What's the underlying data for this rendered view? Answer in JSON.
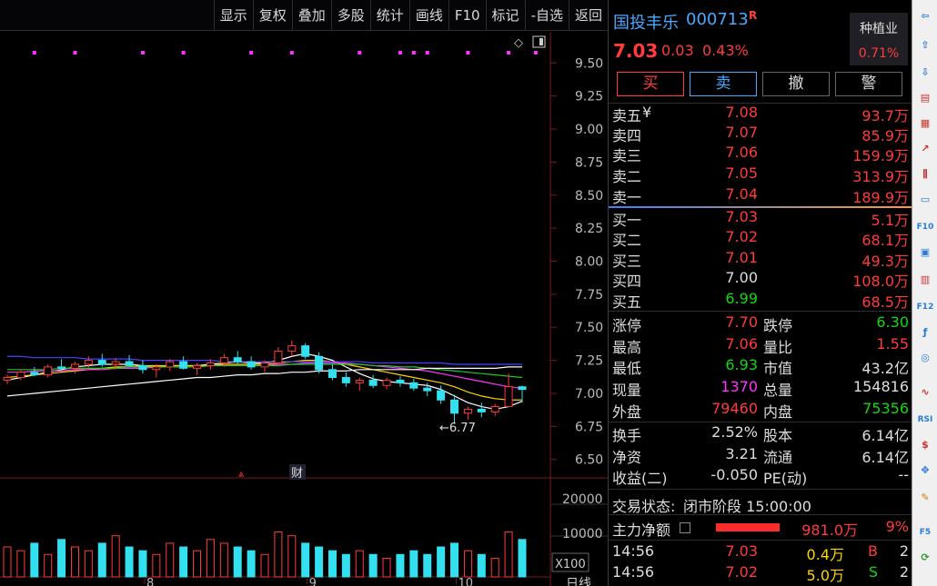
{
  "toolbar": {
    "items": [
      "显示",
      "复权",
      "叠加",
      "多股",
      "统计",
      "画线",
      "F10",
      "标记",
      "-自选",
      "返回"
    ]
  },
  "stock": {
    "name": "国投丰乐",
    "code": "000713",
    "flag": "R",
    "price": "7.03",
    "change": "0.03",
    "pct": "0.43%"
  },
  "sector": {
    "name": "种植业",
    "pct": "0.71%"
  },
  "trade_buttons": [
    "买",
    "卖",
    "撤",
    "警"
  ],
  "asks": [
    {
      "label": "卖五",
      "mark": "¥",
      "price": "7.08",
      "vol": "93.7万"
    },
    {
      "label": "卖四",
      "mark": "",
      "price": "7.07",
      "vol": "85.9万"
    },
    {
      "label": "卖三",
      "mark": "",
      "price": "7.06",
      "vol": "159.9万"
    },
    {
      "label": "卖二",
      "mark": "",
      "price": "7.05",
      "vol": "313.9万"
    },
    {
      "label": "卖一",
      "mark": "",
      "price": "7.04",
      "vol": "189.9万"
    }
  ],
  "bids": [
    {
      "label": "买一",
      "price": "7.03",
      "vol": "5.1万"
    },
    {
      "label": "买二",
      "price": "7.02",
      "vol": "68.1万"
    },
    {
      "label": "买三",
      "price": "7.01",
      "vol": "49.3万"
    },
    {
      "label": "买四",
      "price": "7.00",
      "vol": "108.0万"
    },
    {
      "label": "买五",
      "price": "6.99",
      "vol": "68.5万"
    }
  ],
  "stats": [
    {
      "l1": "涨停",
      "v1": "7.70",
      "l2": "跌停",
      "v2": "6.30"
    },
    {
      "l1": "最高",
      "v1": "7.06",
      "l2": "量比",
      "v2": "1.55"
    },
    {
      "l1": "最低",
      "v1": "6.93",
      "l2": "市值",
      "v2": "43.2亿"
    },
    {
      "l1": "现量",
      "v1": "1370",
      "l2": "总量",
      "v2": "154816"
    },
    {
      "l1": "外盘",
      "v1": "79460",
      "l2": "内盘",
      "v2": "75356"
    }
  ],
  "fund": [
    {
      "l1": "换手",
      "v1": "2.52%",
      "l2": "股本",
      "v2": "6.14亿"
    },
    {
      "l1": "净资",
      "v1": "3.21",
      "l2": "流通",
      "v2": "6.14亿"
    },
    {
      "l1": "收益(二)",
      "v1": "-0.050",
      "l2": "PE(动)",
      "v2": "--"
    }
  ],
  "status": {
    "label": "交易状态:",
    "value": "闭市阶段 15:00:00"
  },
  "main_force": {
    "label": "主力净额",
    "amount": "981.0万",
    "pct": "9%"
  },
  "ticks": [
    {
      "time": "14:56",
      "price": "7.03",
      "vol": "0.4万",
      "side": "B",
      "n": "2"
    },
    {
      "time": "14:56",
      "price": "7.02",
      "vol": "5.0万",
      "side": "S",
      "n": "2"
    }
  ],
  "price_axis": [
    "9.50",
    "9.25",
    "9.00",
    "8.75",
    "8.50",
    "8.25",
    "8.00",
    "7.75",
    "7.50",
    "7.25",
    "7.00",
    "6.75",
    "6.50"
  ],
  "vol_axis": [
    "20000",
    "10000"
  ],
  "vol_unit": "X100",
  "x_labels": [
    "8",
    "9",
    "10"
  ],
  "low_annotation": "6.77",
  "cai_label": "财",
  "period_label": "日线",
  "chart_data": {
    "type": "candlestick",
    "ylim": [
      6.45,
      9.55
    ],
    "candles": [
      [
        7.1,
        7.14,
        7.07,
        7.12
      ],
      [
        7.12,
        7.18,
        7.1,
        7.16
      ],
      [
        7.16,
        7.2,
        7.13,
        7.14
      ],
      [
        7.14,
        7.22,
        7.12,
        7.2
      ],
      [
        7.2,
        7.26,
        7.17,
        7.19
      ],
      [
        7.19,
        7.24,
        7.15,
        7.22
      ],
      [
        7.22,
        7.28,
        7.19,
        7.25
      ],
      [
        7.25,
        7.3,
        7.2,
        7.22
      ],
      [
        7.22,
        7.27,
        7.18,
        7.24
      ],
      [
        7.24,
        7.29,
        7.2,
        7.21
      ],
      [
        7.21,
        7.25,
        7.15,
        7.18
      ],
      [
        7.18,
        7.22,
        7.12,
        7.2
      ],
      [
        7.2,
        7.26,
        7.17,
        7.24
      ],
      [
        7.24,
        7.28,
        7.18,
        7.19
      ],
      [
        7.19,
        7.23,
        7.14,
        7.21
      ],
      [
        7.21,
        7.26,
        7.18,
        7.23
      ],
      [
        7.23,
        7.3,
        7.2,
        7.27
      ],
      [
        7.27,
        7.32,
        7.22,
        7.24
      ],
      [
        7.24,
        7.28,
        7.18,
        7.2
      ],
      [
        7.2,
        7.25,
        7.16,
        7.23
      ],
      [
        7.23,
        7.35,
        7.21,
        7.32
      ],
      [
        7.32,
        7.4,
        7.28,
        7.36
      ],
      [
        7.36,
        7.38,
        7.26,
        7.28
      ],
      [
        7.28,
        7.31,
        7.15,
        7.18
      ],
      [
        7.18,
        7.22,
        7.1,
        7.12
      ],
      [
        7.12,
        7.16,
        7.05,
        7.08
      ],
      [
        7.08,
        7.12,
        7.02,
        7.1
      ],
      [
        7.1,
        7.14,
        7.04,
        7.06
      ],
      [
        7.06,
        7.12,
        7.03,
        7.1
      ],
      [
        7.1,
        7.13,
        7.05,
        7.08
      ],
      [
        7.08,
        7.11,
        7.02,
        7.04
      ],
      [
        7.04,
        7.08,
        6.98,
        7.02
      ],
      [
        7.02,
        7.06,
        6.92,
        6.95
      ],
      [
        6.95,
        6.99,
        6.77,
        6.85
      ],
      [
        6.85,
        6.9,
        6.8,
        6.88
      ],
      [
        6.88,
        6.93,
        6.82,
        6.86
      ],
      [
        6.86,
        6.92,
        6.83,
        6.9
      ],
      [
        6.9,
        7.15,
        6.9,
        7.05
      ],
      [
        7.05,
        7.06,
        6.93,
        7.03
      ]
    ],
    "ma": [
      {
        "name": "MA5",
        "color": "#ffffff",
        "values": [
          7.1,
          7.12,
          7.14,
          7.16,
          7.18,
          7.2,
          7.21,
          7.22,
          7.22,
          7.22,
          7.21,
          7.2,
          7.21,
          7.21,
          7.21,
          7.22,
          7.23,
          7.24,
          7.23,
          7.23,
          7.25,
          7.28,
          7.3,
          7.28,
          7.25,
          7.2,
          7.15,
          7.11,
          7.09,
          7.08,
          7.07,
          7.06,
          7.03,
          6.98,
          6.93,
          6.9,
          6.88,
          6.9,
          6.94
        ]
      },
      {
        "name": "MA10",
        "color": "#ffd400",
        "values": [
          7.12,
          7.13,
          7.14,
          7.15,
          7.16,
          7.17,
          7.18,
          7.19,
          7.2,
          7.2,
          7.21,
          7.21,
          7.21,
          7.21,
          7.21,
          7.21,
          7.22,
          7.22,
          7.22,
          7.22,
          7.23,
          7.24,
          7.25,
          7.25,
          7.24,
          7.22,
          7.2,
          7.18,
          7.16,
          7.14,
          7.12,
          7.1,
          7.08,
          7.05,
          7.01,
          6.98,
          6.96,
          6.95,
          6.95
        ]
      },
      {
        "name": "MA20",
        "color": "#ff33ff",
        "values": [
          7.16,
          7.16,
          7.17,
          7.17,
          7.17,
          7.18,
          7.18,
          7.18,
          7.19,
          7.19,
          7.19,
          7.2,
          7.2,
          7.2,
          7.2,
          7.21,
          7.21,
          7.21,
          7.21,
          7.21,
          7.22,
          7.22,
          7.23,
          7.23,
          7.23,
          7.23,
          7.22,
          7.21,
          7.2,
          7.19,
          7.18,
          7.17,
          7.15,
          7.13,
          7.11,
          7.09,
          7.07,
          7.05,
          7.04
        ]
      },
      {
        "name": "MA30",
        "color": "#22cc22",
        "values": [
          7.18,
          7.18,
          7.18,
          7.18,
          7.19,
          7.19,
          7.19,
          7.19,
          7.19,
          7.2,
          7.2,
          7.2,
          7.2,
          7.2,
          7.2,
          7.21,
          7.21,
          7.21,
          7.21,
          7.21,
          7.21,
          7.22,
          7.22,
          7.22,
          7.22,
          7.22,
          7.22,
          7.21,
          7.21,
          7.2,
          7.2,
          7.19,
          7.18,
          7.17,
          7.16,
          7.15,
          7.14,
          7.13,
          7.12
        ]
      },
      {
        "name": "MA60",
        "color": "#4444ff",
        "values": [
          7.28,
          7.28,
          7.27,
          7.27,
          7.27,
          7.27,
          7.26,
          7.26,
          7.26,
          7.26,
          7.25,
          7.25,
          7.25,
          7.25,
          7.25,
          7.25,
          7.24,
          7.24,
          7.24,
          7.24,
          7.24,
          7.24,
          7.24,
          7.24,
          7.24,
          7.24,
          7.24,
          7.23,
          7.23,
          7.23,
          7.23,
          7.23,
          7.23,
          7.22,
          7.22,
          7.22,
          7.22,
          7.22,
          7.22
        ]
      },
      {
        "name": "MA120",
        "color": "#ffffff",
        "values": [
          6.98,
          6.99,
          7.0,
          7.01,
          7.02,
          7.03,
          7.04,
          7.05,
          7.06,
          7.07,
          7.08,
          7.09,
          7.1,
          7.11,
          7.12,
          7.12,
          7.13,
          7.14,
          7.14,
          7.15,
          7.15,
          7.16,
          7.16,
          7.17,
          7.17,
          7.17,
          7.18,
          7.18,
          7.18,
          7.18,
          7.18,
          7.19,
          7.19,
          7.19,
          7.19,
          7.19,
          7.19,
          7.2,
          7.2
        ]
      }
    ],
    "volume": [
      8,
      7,
      9,
      6,
      10,
      8,
      7,
      9,
      11,
      8,
      7,
      6,
      9,
      8,
      7,
      10,
      9,
      8,
      7,
      6,
      12,
      11,
      9,
      8,
      7,
      6,
      7,
      6,
      5,
      6,
      7,
      6,
      8,
      9,
      7,
      6,
      5,
      12,
      10
    ],
    "vol_max": 25000,
    "signal_dots": [
      2,
      5,
      10,
      13,
      18,
      21,
      26,
      29,
      30,
      31,
      34,
      37,
      39
    ],
    "x_tick_index": [
      10,
      22,
      33
    ]
  }
}
